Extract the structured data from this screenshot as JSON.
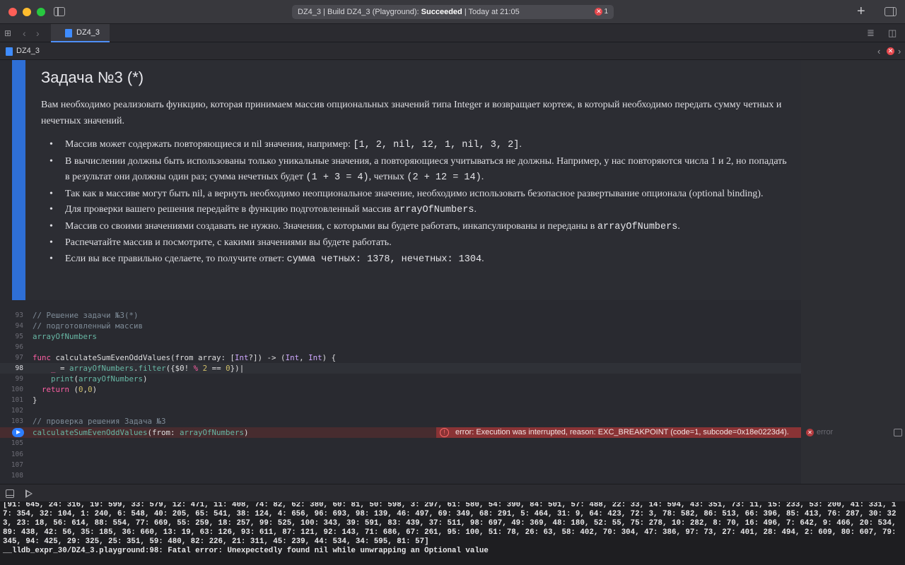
{
  "window": {
    "status_prefix": "DZ4_3 | Build DZ4_3 (Playground): ",
    "status_state": "Succeeded",
    "status_suffix": " | Today at 21:05",
    "error_count": "1",
    "icons": {
      "sidebar_toggle": "sidebar-left-icon",
      "add": "plus-icon",
      "inspector": "sidebar-right-icon",
      "error": "x-circle-icon"
    },
    "colors": {
      "close": "#ff5f57",
      "minimize": "#febc2e",
      "zoom": "#28c840",
      "error": "#e5484d",
      "accent": "#2e6fd6"
    }
  },
  "tabbar": {
    "tab_label": "DZ4_3",
    "grid_icon": "⊞",
    "back_icon": "‹",
    "forward_icon": "›",
    "editor_options_icon": "≣",
    "split_icon": "◫"
  },
  "jumpbar": {
    "file_label": "DZ4_3",
    "prev_icon": "‹",
    "next_icon": "›",
    "error_icon": "✕"
  },
  "markdown": {
    "title": "Задача №3 (*)",
    "intro": "Вам необходимо реализовать функцию, которая принимаем массив опциональных значений типа Integer и возвращает кортеж, в который необходимо передать сумму четных и нечетных значений.",
    "bullets": [
      {
        "text": "Массив может содержать повторяющиеся и nil значения, например: ",
        "code": "[1, 2, nil, 12, 1, nil, 3, 2]",
        "tail": "."
      },
      {
        "text": "В вычислении должны быть использованы только уникальные значения, а повторяющиеся учитываться не должны. Например, у нас повторяются числа 1 и 2, но попадать в результат они должны один раз; сумма нечетных будет ",
        "code": "(1 + 3 = 4)",
        "mid": ", четных ",
        "code2": "(2 + 12 = 14)",
        "tail": "."
      },
      {
        "text": "Так как в массиве могут быть nil, а вернуть необходимо неопциональное значение, необходимо использовать безопасное развертывание опционала (optional binding)."
      },
      {
        "text": "Для проверки вашего решения передайте в функцию подготовленный массив ",
        "code": "arrayOfNumbers",
        "tail": "."
      },
      {
        "text": "Массив со своими значениями создавать не нужно. Значения, с которыми вы будете работать, инкапсулированы и переданы в ",
        "code": "arrayOfNumbers",
        "tail": "."
      },
      {
        "text": "Распечатайте массив и посмотрите, с какими значениями вы будете работать."
      },
      {
        "text": "Если вы все правильно сделаете, то получите ответ: ",
        "code": "сумма четных: 1378, нечетных: 1304",
        "tail": "."
      }
    ]
  },
  "code": {
    "line_numbers": [
      "93",
      "94",
      "95",
      "96",
      "97",
      "98",
      "99",
      "100",
      "101",
      "102",
      "103",
      "104",
      "105",
      "106",
      "107",
      "108"
    ],
    "l93": "// Решение задачи №3(*)",
    "l94": "// подготовленный массив",
    "l95": "arrayOfNumbers",
    "l97": {
      "kw": "func",
      "name": " calculateSumEvenOddValues(from array: [",
      "t1": "Int",
      "p1": "?]) -> (",
      "t2": "Int",
      "p2": ", ",
      "t3": "Int",
      "p3": ") {"
    },
    "l98": {
      "us": "_",
      "eq": " = ",
      "id": "arrayOfNumbers",
      "dot": ".",
      "fn": "filter",
      "a": "({$0! ",
      "op": "%",
      "sp": " ",
      "n1": "2",
      "eqeq": " == ",
      "n2": "0",
      "z": "})"
    },
    "l99": {
      "fn": "print",
      "a": "(",
      "id": "arrayOfNumbers",
      "z": ")"
    },
    "l100": {
      "kw": "return",
      "a": " (",
      "n1": "0",
      "c": ",",
      "n2": "0",
      "z": ")"
    },
    "l101": "}",
    "l103": "// проверка решения Задача №3",
    "l104": {
      "fn": "calculateSumEvenOddValues",
      "a": "(from: ",
      "id": "arrayOfNumbers",
      "z": ")"
    }
  },
  "error": {
    "icon": "!",
    "message": "error: Execution was interrupted, reason: EXC_BREAKPOINT (code=1, subcode=0x18e0223d4).",
    "tag_icon": "✕",
    "tag": "error"
  },
  "console": {
    "text": "[91: 645, 24: 316, 19: 599, 33: 579, 12: 471, 11: 408, 74: 82, 62: 380, 60: 81, 50: 598, 3: 297, 61: 580, 54: 390, 84: 501, 57: 488, 22: 33, 14: 594, 43: 351, 73: 11, 15: 233, 53: 200, 41: 331, 17: 354, 32: 104, 1: 240, 6: 548, 40: 205, 65: 541, 38: 124, 4: 656, 96: 693, 98: 139, 46: 497, 69: 349, 68: 291, 5: 464, 31: 9, 64: 423, 72: 3, 78: 582, 86: 513, 66: 396, 85: 413, 76: 287, 30: 323, 23: 18, 56: 614, 88: 554, 77: 669, 55: 259, 18: 257, 99: 525, 100: 343, 39: 591, 83: 439, 37: 511, 98: 697, 49: 369, 48: 180, 52: 55, 75: 278, 10: 282, 8: 70, 16: 496, 7: 642, 9: 466, 20: 534, 89: 438, 42: 56, 35: 185, 36: 660, 13: 19, 63: 126, 93: 611, 87: 121, 92: 143, 71: 686, 67: 261, 95: 100, 51: 78, 26: 63, 58: 402, 70: 304, 47: 386, 97: 73, 27: 401, 28: 494, 2: 609, 80: 607, 79: 345, 94: 425, 29: 325, 25: 351, 59: 480, 82: 226, 21: 311, 45: 239, 44: 534, 34: 595, 81: 57]\n__lldb_expr_30/DZ4_3.playground:98: Fatal error: Unexpectedly found nil while unwrapping an Optional value"
  }
}
